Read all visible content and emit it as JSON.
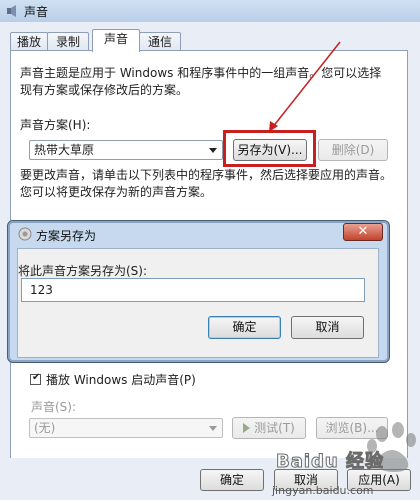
{
  "window": {
    "title": "声音",
    "tabs": [
      {
        "label": "播放"
      },
      {
        "label": "录制"
      },
      {
        "label": "声音"
      },
      {
        "label": "通信"
      }
    ],
    "active_tab": "声音"
  },
  "sound_tab": {
    "description": "声音主题是应用于 Windows 和程序事件中的一组声音。您可以选择现有方案或保存修改后的方案。",
    "scheme_label": "声音方案(H):",
    "scheme_value": "热带大草原",
    "save_as_label": "另存为(V)...",
    "delete_label": "删除(D)",
    "change_description": "要更改声音，请单击以下列表中的程序事件，然后选择要应用的声音。您可以将更改保存为新的声音方案。",
    "startup_sound_label": "播放 Windows 启动声音(P)",
    "startup_sound_checked": true,
    "sounds_label": "声音(S):",
    "sounds_value": "(无)",
    "test_label": "测试(T)",
    "browse_label": "浏览(B)..."
  },
  "dialog": {
    "title": "方案另存为",
    "prompt": "将此声音方案另存为(S):",
    "input_value": "123",
    "ok_label": "确定",
    "cancel_label": "取消"
  },
  "footer": {
    "ok_label": "确定",
    "cancel_label": "取消",
    "apply_label": "应用(A)"
  },
  "watermark": {
    "text": "Baidu 经验",
    "sub": "jingyan.baidu.com"
  },
  "colors": {
    "highlight_box": "#c81f1f",
    "annotation_arrow": "#c81f1f"
  }
}
